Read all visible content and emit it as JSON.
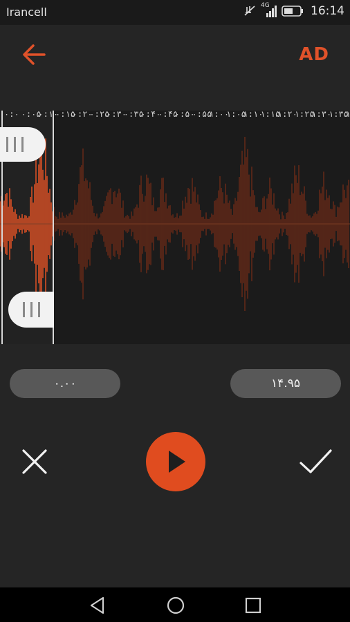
{
  "status_bar": {
    "carrier": "Irancell",
    "network": "4G",
    "time": "16:14",
    "icons": [
      "mute-icon",
      "signal-icon",
      "battery-icon"
    ]
  },
  "app_bar": {
    "back_icon": "arrow-left-icon",
    "ad_label": "AD"
  },
  "timeline": {
    "ticks": [
      "۰:۰",
      "۰:۰۵",
      "۰:۱۰",
      "۰:۱۵",
      "۰:۲۰",
      "۰:۲۵",
      "۰:۳۰",
      "۰:۳۵",
      "۰:۴۰",
      "۰:۴۵",
      "۰:۵۰",
      "۰:۵۵",
      "۱:۰۰",
      "۱:۰۵",
      "۱:۱۰",
      "۱:۱۵",
      "۱:۲۰",
      "۱:۲۵",
      "۱:۳۰",
      "۱:۳۵",
      "۱:۴"
    ]
  },
  "selection": {
    "start_time": "۰.۰۰",
    "end_time": "۱۴.۹۵"
  },
  "controls": {
    "cancel_icon": "close-icon",
    "play_icon": "play-icon",
    "confirm_icon": "check-icon"
  },
  "colors": {
    "accent": "#e04c1f",
    "waveform_selected": "#f0501e",
    "waveform_unselected": "#6b2a18",
    "background": "#252525",
    "pill": "#585858"
  },
  "nav_bar": {
    "icons": [
      "back-triangle-icon",
      "home-circle-icon",
      "recents-square-icon"
    ]
  }
}
